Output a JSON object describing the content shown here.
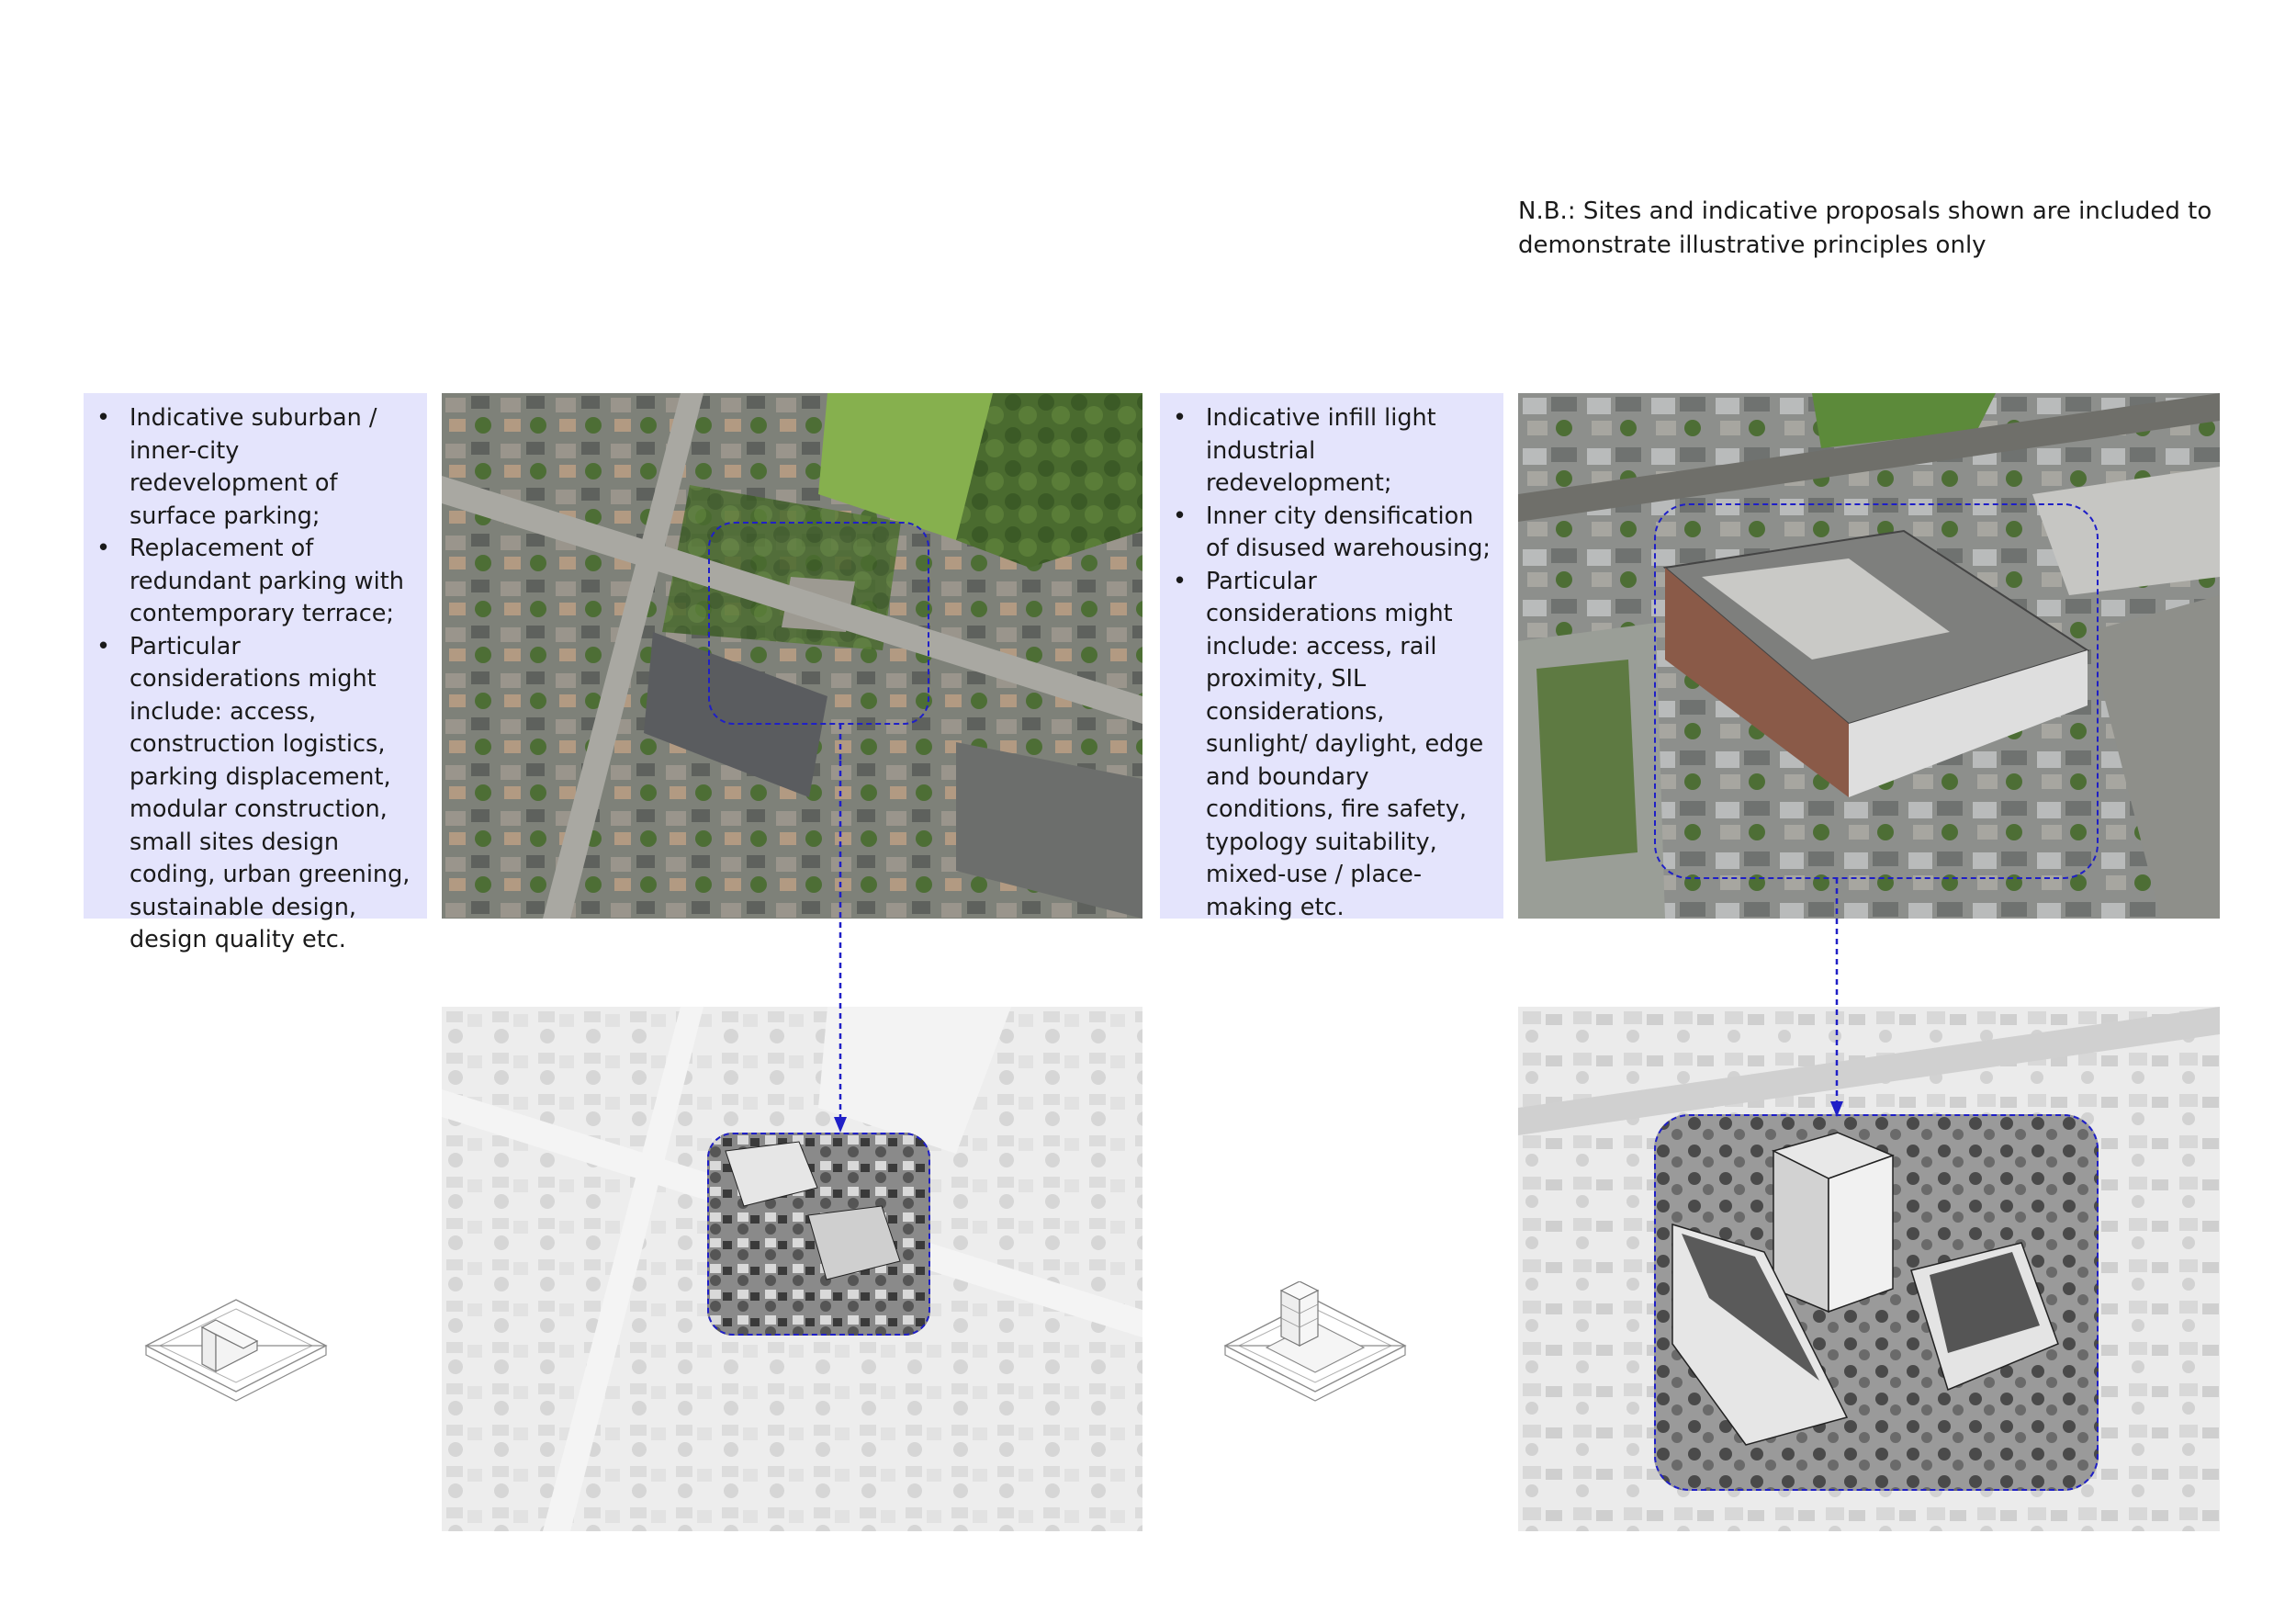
{
  "note": {
    "text": "N.B.: Sites and indicative proposals shown are included to demonstrate illustrative principles only"
  },
  "site_1": {
    "bullets": [
      "Indicative suburban / inner-city redevelopment of surface parking;",
      "Replacement of redundant parking with contemporary terrace;",
      "Particular considerations might include: access, construction logistics, parking displacement, modular construction, small sites design coding, urban greening, sustainable design, design quality etc."
    ]
  },
  "site_2": {
    "bullets": [
      "Indicative infill light industrial redevelopment;",
      "Inner city densification of disused warehousing;",
      "Particular considerations might include: access, rail proximity, SIL considerations, sunlight/ daylight, edge and boundary conditions, fire safety, typology suitability, mixed-use / place-making etc."
    ]
  },
  "colors": {
    "text_panel": "#e4e4fc",
    "dashed_outline": "#1f1fc7",
    "sketch_background": "#ececec"
  }
}
